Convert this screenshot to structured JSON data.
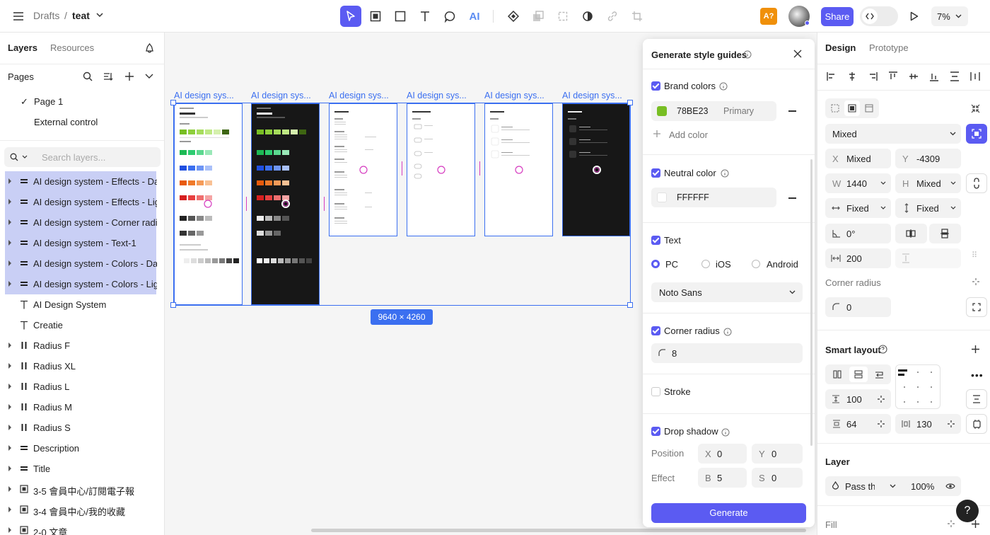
{
  "topbar": {
    "breadcrumb_root": "Drafts",
    "breadcrumb_sep": "/",
    "file_name": "teat",
    "avatar_badge": "A?",
    "share_label": "Share",
    "zoom": "7%"
  },
  "left": {
    "tab_layers": "Layers",
    "tab_resources": "Resources",
    "pages_title": "Pages",
    "pages": [
      {
        "label": "Page 1",
        "checked": "✓"
      },
      {
        "label": "External control"
      }
    ],
    "search_placeholder": "Search layers...",
    "layers": [
      {
        "label": "AI design system - Effects - Dark"
      },
      {
        "label": "AI design system - Effects - Light"
      },
      {
        "label": "AI design system - Corner radius"
      },
      {
        "label": "AI design system - Text-1"
      },
      {
        "label": "AI design system - Colors - Dark"
      },
      {
        "label": "AI design system - Colors - Light"
      },
      {
        "label": "AI Design System"
      },
      {
        "label": "Creatie"
      },
      {
        "label": "Radius F"
      },
      {
        "label": "Radius XL"
      },
      {
        "label": "Radius L"
      },
      {
        "label": "Radius M"
      },
      {
        "label": "Radius S"
      },
      {
        "label": "Description"
      },
      {
        "label": "Title"
      },
      {
        "label": "3-5 會員中心/訂閱電子報"
      },
      {
        "label": "3-4 會員中心/我的收藏"
      },
      {
        "label": "2-0 文章"
      }
    ]
  },
  "canvas": {
    "frame_labels": [
      "AI design sys...",
      "AI design sys...",
      "AI design sys...",
      "AI design sys...",
      "AI design sys...",
      "AI design sys..."
    ],
    "selection_size": "9640 × 4260"
  },
  "modal": {
    "title": "Generate style guides",
    "brand_colors_label": "Brand colors",
    "brand_color_hex": "78BE23",
    "brand_color_value": "#78BE23",
    "brand_color_role": "Primary",
    "add_color": "Add color",
    "neutral_color_label": "Neutral color",
    "neutral_color_hex": "FFFFFF",
    "text_label": "Text",
    "platform_pc": "PC",
    "platform_ios": "iOS",
    "platform_android": "Android",
    "font": "Noto Sans",
    "corner_radius_label": "Corner radius",
    "corner_radius_value": "8",
    "stroke_label": "Stroke",
    "drop_shadow_label": "Drop shadow",
    "position_label": "Position",
    "x_key": "X",
    "x_value": "0",
    "y_key": "Y",
    "y_value": "0",
    "effect_label": "Effect",
    "b_key": "B",
    "b_value": "5",
    "s_key": "S",
    "s_value": "0",
    "generate_label": "Generate"
  },
  "right": {
    "tab_design": "Design",
    "tab_prototype": "Prototype",
    "mixed_select": "Mixed",
    "x_key": "X",
    "x_value": "Mixed",
    "y_key": "Y",
    "y_value": "-4309",
    "w_key": "W",
    "w_value": "1440",
    "h_key": "H",
    "h_value": "Mixed",
    "width_mode": "Fixed",
    "height_mode": "Fixed",
    "rotation": "0°",
    "spacing": "200",
    "corner_radius_title": "Corner radius",
    "corner_radius_value": "0",
    "smart_layout_title": "Smart layout",
    "gap_value": "100",
    "padding_value": "64",
    "padding_h_value": "130",
    "layer_title": "Layer",
    "blend_mode": "Pass throu",
    "opacity": "100%",
    "fill_title": "Fill"
  },
  "colors": {
    "accent": "#5B5BF2",
    "selection": "#3B6FF0",
    "brand_green": "#78BE23",
    "avatar_badge_bg": "#F0900A"
  }
}
